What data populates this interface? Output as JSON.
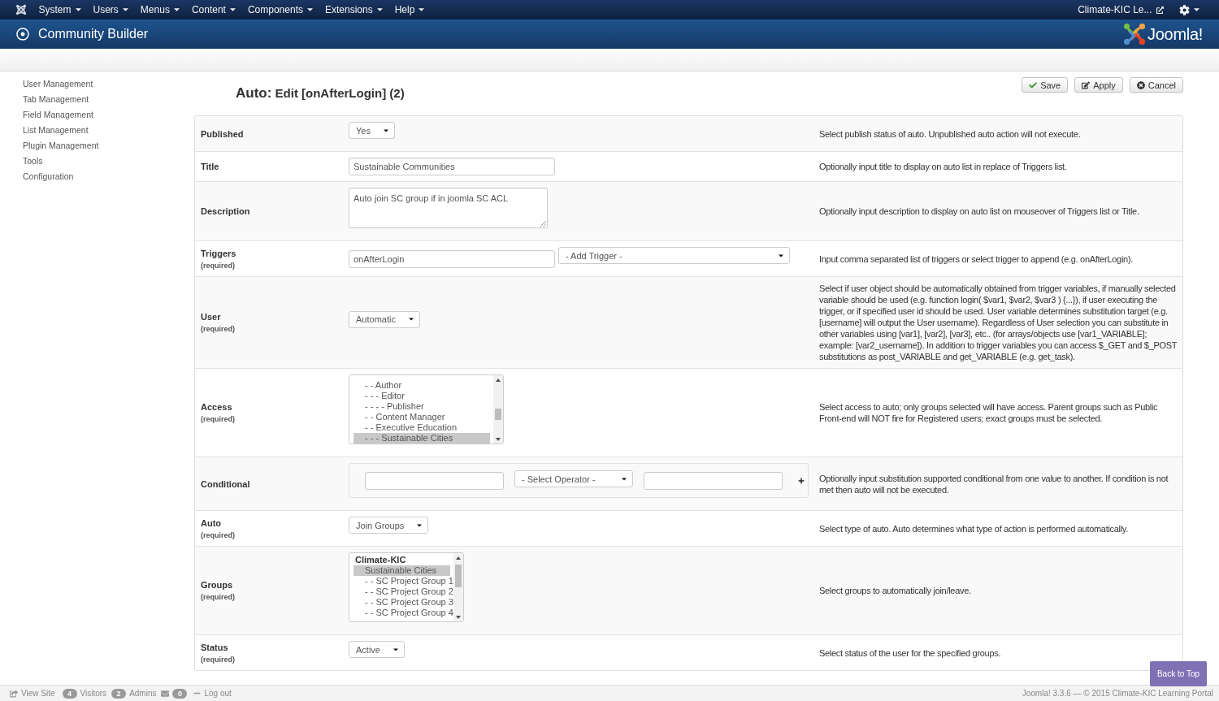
{
  "navbar": {
    "menus": [
      "System",
      "Users",
      "Menus",
      "Content",
      "Components",
      "Extensions",
      "Help"
    ],
    "site_link": "Climate-KIC Le..."
  },
  "header": {
    "title": "Community Builder",
    "brand": "Joomla!"
  },
  "sidebar": {
    "items": [
      "User Management",
      "Tab Management",
      "Field Management",
      "List Management",
      "Plugin Management",
      "Tools",
      "Configuration"
    ]
  },
  "page_title": {
    "prefix": "Auto:",
    "text": "Edit [onAfterLogin] (2)"
  },
  "toolbar": {
    "buttons": [
      {
        "kind": "save",
        "label": "Save"
      },
      {
        "kind": "apply",
        "label": "Apply"
      },
      {
        "kind": "cancel",
        "label": "Cancel"
      }
    ]
  },
  "form": {
    "rows": [
      {
        "label": "Published",
        "kind": "select",
        "value": "Yes",
        "description": "Select publish status of auto. Unpublished auto action will not execute."
      },
      {
        "label": "Title",
        "kind": "input",
        "value": "Sustainable Communities",
        "description": "Optionally input title to display on auto list in replace of Triggers list."
      },
      {
        "label": "Description",
        "kind": "textarea",
        "value": "Auto join SC group if in joomla SC ACL",
        "description": "Optionally input description to display on auto list on mouseover of Triggers list or Title."
      },
      {
        "label": "Triggers",
        "required": "(required)",
        "kind": "input_select",
        "value": "onAfterLogin",
        "select": "- Add Trigger -",
        "description": "Input comma separated list of triggers or select trigger to append (e.g. onAfterLogin)."
      },
      {
        "label": "User",
        "required": "(required)",
        "kind": "select",
        "value": "Automatic",
        "description": "Select if user object should be automatically obtained from trigger variables, if manually selected variable should be used (e.g. function login( $var1, $var2, $var3 ) {...}), if user executing the trigger, or if specified user id should be used. User variable determines substitution target (e.g. [username] will output the User username). Regardless of User selection you can substitute in other variables using [var1], [var2], [var3], etc.. (for arrays/objects use [var1_VARIABLE]; example: [var2_username]). In addition to trigger variables you can access $_GET and $_POST substitutions as post_VARIABLE and get_VARIABLE (e.g. get_task)."
      },
      {
        "label": "Access",
        "required": "(required)",
        "kind": "listbox",
        "options": [
          {
            "kind": "option",
            "label": "- - Author",
            "selected": false
          },
          {
            "kind": "option",
            "label": "- - - Editor",
            "selected": false
          },
          {
            "kind": "option",
            "label": "- - - - Publisher",
            "selected": false
          },
          {
            "kind": "option",
            "label": "- - Content Manager",
            "selected": false
          },
          {
            "kind": "option",
            "label": "- - Executive Education",
            "selected": false
          },
          {
            "kind": "option",
            "label": "- - - Sustainable Cities",
            "selected": true
          }
        ],
        "description": "Select access to auto; only groups selected will have access. Parent groups such as Public Front-end will NOT fire for Registered users; exact groups must be selected."
      },
      {
        "label": "Conditional",
        "kind": "conditional",
        "operator": "- Select Operator -",
        "description": "Optionally input substitution supported conditional from one value to another. If condition is not met then auto will not be executed."
      },
      {
        "label": "Auto",
        "required": "(required)",
        "kind": "select",
        "value": "Join Groups",
        "description": "Select type of auto. Auto determines what type of action is performed automatically."
      },
      {
        "label": "Groups",
        "required": "(required)",
        "kind": "listbox",
        "options": [
          {
            "kind": "group",
            "label": "Climate-KIC",
            "selected": false
          },
          {
            "kind": "option",
            "label": "Sustainable Cities",
            "selected": true
          },
          {
            "kind": "option",
            "label": "- - SC Project Group 1",
            "selected": false
          },
          {
            "kind": "option",
            "label": "- - SC Project Group 2",
            "selected": false
          },
          {
            "kind": "option",
            "label": "- - SC Project Group 3",
            "selected": false
          },
          {
            "kind": "option",
            "label": "- - SC Project Group 4",
            "selected": false
          }
        ],
        "description": "Select groups to automatically join/leave."
      },
      {
        "label": "Status",
        "required": "(required)",
        "kind": "select",
        "value": "Active",
        "description": "Select status of the user for the specified groups."
      }
    ]
  },
  "back_to_top": "Back to Top",
  "status_bar": {
    "items": [
      {
        "kind": "link",
        "label": "View Site"
      },
      {
        "kind": "count",
        "count": "4",
        "label": "Visitors"
      },
      {
        "kind": "count",
        "count": "2",
        "label": "Admins"
      },
      {
        "kind": "messages",
        "count": "0"
      },
      {
        "kind": "logout",
        "label": "Log out"
      }
    ],
    "version": "Joomla! 3.3.6 — © 2015 Climate-KIC Learning Portal"
  }
}
